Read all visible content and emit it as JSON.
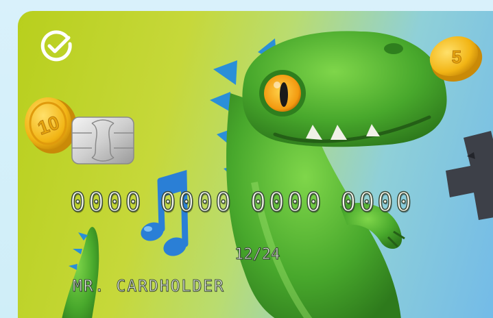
{
  "card": {
    "number_groups": [
      "0000",
      "0000",
      "0000",
      "0000"
    ],
    "expiry": "12/24",
    "holder": "MR. CARDHOLDER"
  },
  "icons": {
    "logo": "checkmark-circle-logo",
    "chip": "emv-chip",
    "coin_left": "coin-10",
    "coin_right": "coin-5",
    "music": "music-notes",
    "character": "green-dinosaur",
    "gamepad": "gamepad-cross"
  },
  "coins": {
    "left_value": "10",
    "right_value": "5"
  },
  "colors": {
    "card_left": "#b8cf1d",
    "card_right": "#6fb8ea",
    "dino": "#4caf2e",
    "coin": "#f2b515",
    "music": "#2a7fd6"
  }
}
